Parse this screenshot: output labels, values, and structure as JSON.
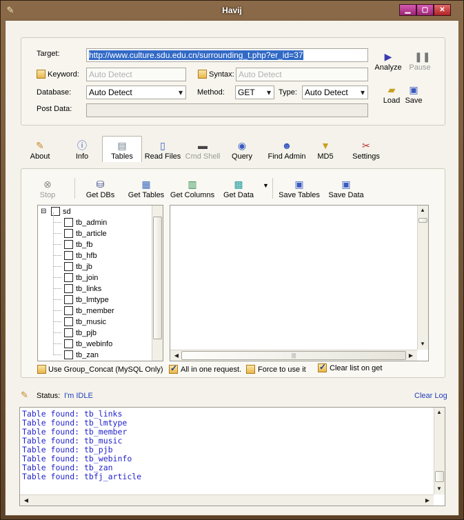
{
  "window": {
    "title": "Havij"
  },
  "target": {
    "label": "Target:",
    "url": "http://www.culture.sdu.edu.cn/surrounding_t.php?er_id=37",
    "keyword_label": "Keyword:",
    "keyword_placeholder": "Auto Detect",
    "syntax_label": "Syntax:",
    "syntax_placeholder": "Auto Detect",
    "database_label": "Database:",
    "database_value": "Auto Detect",
    "method_label": "Method:",
    "method_value": "GET",
    "type_label": "Type:",
    "type_value": "Auto Detect",
    "postdata_label": "Post Data:",
    "postdata_value": ""
  },
  "actions": {
    "analyze": "Analyze",
    "pause": "Pause",
    "load": "Load",
    "save": "Save"
  },
  "tabs": [
    {
      "label": "About",
      "icon": "brush-icon"
    },
    {
      "label": "Info",
      "icon": "info-icon"
    },
    {
      "label": "Tables",
      "icon": "table-icon",
      "active": true
    },
    {
      "label": "Read Files",
      "icon": "file-icon"
    },
    {
      "label": "Cmd Shell",
      "icon": "terminal-icon",
      "disabled": true
    },
    {
      "label": "Query",
      "icon": "query-icon"
    },
    {
      "label": "Find Admin",
      "icon": "users-icon"
    },
    {
      "label": "MD5",
      "icon": "funnel-icon"
    },
    {
      "label": "Settings",
      "icon": "tools-icon"
    }
  ],
  "toolbar": {
    "stop": "Stop",
    "get_dbs": "Get DBs",
    "get_tables": "Get Tables",
    "get_columns": "Get Columns",
    "get_data": "Get Data",
    "save_tables": "Save Tables",
    "save_data": "Save Data"
  },
  "tree": {
    "root": "sd",
    "items": [
      "tb_admin",
      "tb_article",
      "tb_fb",
      "tb_hfb",
      "tb_jb",
      "tb_join",
      "tb_links",
      "tb_lmtype",
      "tb_member",
      "tb_music",
      "tb_pjb",
      "tb_webinfo",
      "tb_zan"
    ]
  },
  "options": {
    "group_concat": {
      "label": "Use Group_Concat (MySQL Only)",
      "checked": false
    },
    "all_in_one": {
      "label": "All in one request.",
      "checked": true
    },
    "force": {
      "label": "Force to use it",
      "checked": false
    },
    "clear_list": {
      "label": "Clear list on get",
      "checked": true
    }
  },
  "status": {
    "label": "Status:",
    "value": "I'm IDLE",
    "clear_log": "Clear Log"
  },
  "log": [
    "Table found: tb_links",
    "Table found: tb_lmtype",
    "Table found: tb_member",
    "Table found: tb_music",
    "Table found: tb_pjb",
    "Table found: tb_webinfo",
    "Table found: tb_zan",
    "Table found: tbfj_article"
  ],
  "colors": {
    "accent": "#3169c6",
    "log_text": "#2222cc",
    "link": "#1f3dbd"
  }
}
